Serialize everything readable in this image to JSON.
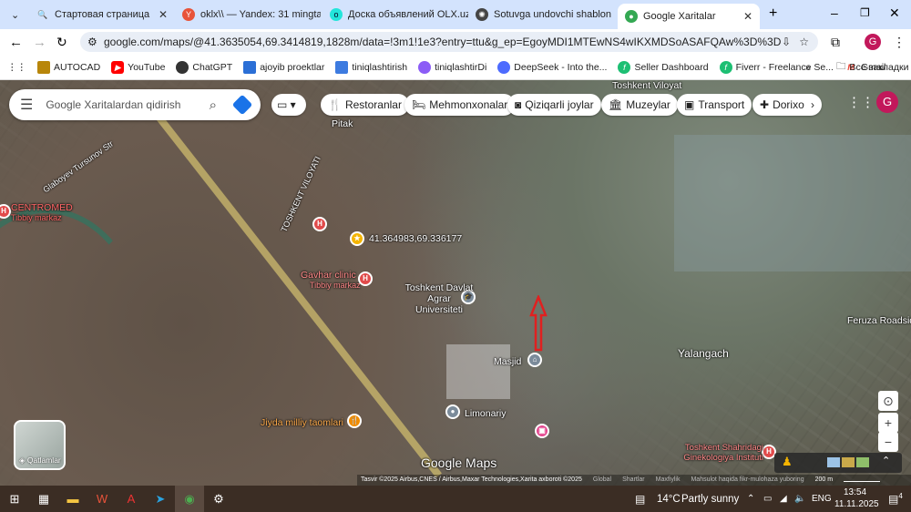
{
  "tabs": [
    {
      "label": "Стартовая страница",
      "icon": "search-icon"
    },
    {
      "label": "oklx\\\\ — Yandex: 31 mingta",
      "icon": "yandex-icon"
    },
    {
      "label": "Доска объявлений OLX.uz",
      "icon": "olx-icon"
    },
    {
      "label": "Sotuvga undovchi shablon",
      "icon": "chatgpt-icon"
    },
    {
      "label": "Google Xaritalar",
      "icon": "maps-pin-icon"
    }
  ],
  "url": "google.com/maps/@41.3635054,69.3414819,1828m/data=!3m1!1e3?entry=ttu&g_ep=EgoyMDI1MTEwNS4wIKXMDSoASAFQAw%3D%3D",
  "profile_initial": "G",
  "bookmarks": [
    "AUTOCAD",
    "YouTube",
    "ChatGPT",
    "ajoyib proektlar",
    "tiniqlashtirish",
    "tiniqlashtirDi",
    "DeepSeek - Into the...",
    "Seller Dashboard",
    "Fiverr - Freelance Se...",
    "Gmail"
  ],
  "all_bookmarks": "Все закладки",
  "map": {
    "search_placeholder": "Google Xaritalardan qidirish",
    "chips": [
      "Restoranlar",
      "Mehmonxonalar",
      "Qiziqarli joylar",
      "Muzeylar",
      "Transport",
      "Dorixo"
    ],
    "layers_label": "Qatlamlar",
    "labels": [
      "Toshkent Viloyat",
      "Pitak",
      "Glaboyev Tursunov Str",
      "CENTROMED",
      "Tibbiy markaz",
      "TOSHKENT VILOYATI",
      "41.364983,69.336177",
      "Gavhar clinic",
      "Tibbiy markaz",
      "Toshkent Davlat Agrar Universiteti",
      "Masjid",
      "Yalangach",
      "Feruza Roadside Station",
      "Limonariy",
      "Jiyda milliy taomlari",
      "Toshkent Shahridagi Ginekologiya Instituti",
      "Google Maps"
    ],
    "attribution": "Tasvir ©2025 Airbus,CNES / Airbus,Maxar Technologies,Xarita axboroti ©2025",
    "links": [
      "Global",
      "Shartlar",
      "Maxfiylik",
      "Mahsulot haqida fikr-mulohaza yuboring"
    ],
    "scale": "200 m"
  },
  "taskbar": {
    "weather_temp": "14°C",
    "weather_text": "Partly sunny",
    "lang": "ENG",
    "time": "13:54",
    "date": "11.11.2025",
    "notifications": "4"
  }
}
